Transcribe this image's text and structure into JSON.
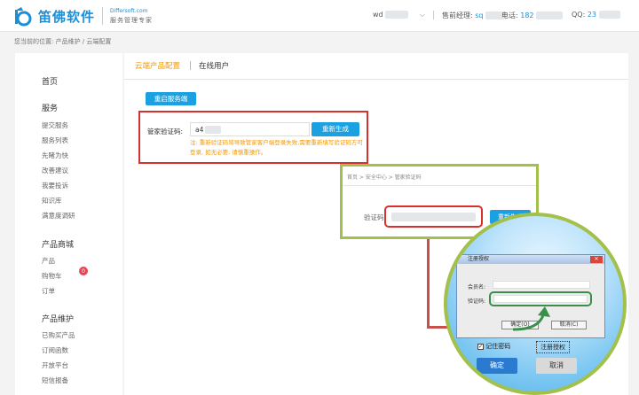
{
  "header": {
    "brand_name": "笛佛软件",
    "brand_domain": "Differsoft.com",
    "brand_tagline": "服务管理专家",
    "user_prefix": "wd",
    "manager_label": "售前经理:",
    "manager_value": "sq",
    "phone_label": "电话:",
    "phone_value": "182",
    "qq_label": "QQ:",
    "qq_value": "23"
  },
  "breadcrumb": "您当前的位置:  产品维护  /  云端配置",
  "sidebar": {
    "home": "首页",
    "service_title": "服务",
    "service_items": [
      "提交服务",
      "服务列表",
      "先睹为快",
      "改善建议",
      "我要投诉",
      "知识库",
      "满意度调研"
    ],
    "mall_title": "产品商城",
    "mall_items": [
      "产品",
      "购物车",
      "订单"
    ],
    "cart_badge": "0",
    "maint_title": "产品维护",
    "maint_items": [
      "已购买产品",
      "订阅函数",
      "开放平台",
      "短信报备"
    ]
  },
  "tabs": {
    "active": "云端产品配置",
    "other": "在线用户"
  },
  "restart_button": "重启服务端",
  "verify": {
    "label": "管家验证码:",
    "value": "a4",
    "regen_button": "重新生成",
    "note": "注: 重新验证码将导致管家客户端登录失败,需要重新填写验证码方可登录, 如无必要, 请慎重操作。"
  },
  "inset": {
    "breadcrumb": "首页 > 安全中心 > 管家验证码",
    "label": "验证码:",
    "regen_button": "重新生成"
  },
  "dialog": {
    "title": "注册授权",
    "member_label": "会员名:",
    "code_label": "验证码:",
    "ok": "确定(O)",
    "cancel": "取消(C)"
  },
  "login": {
    "remember": "记住密码",
    "register": "注册授权",
    "confirm": "确定",
    "cancel": "取消"
  },
  "colors": {
    "accent": "#1ba1e2",
    "highlight_red": "#d7312e",
    "highlight_green": "#a3c14a",
    "warning": "#f39800"
  }
}
